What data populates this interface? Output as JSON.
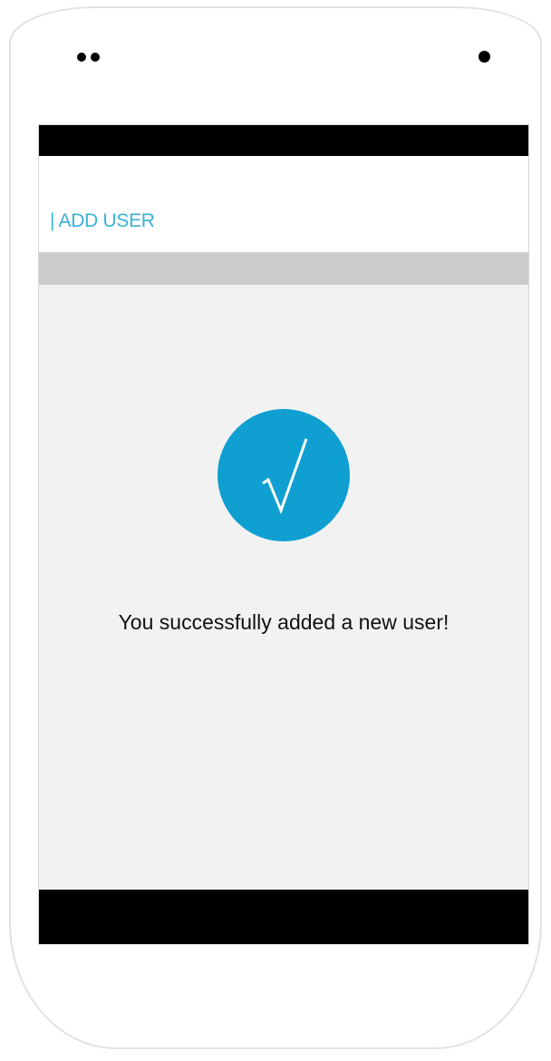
{
  "header": {
    "title": "| ADD USER"
  },
  "success": {
    "icon": "check-icon",
    "glyph": "√",
    "message": "You successfully added a new user!"
  },
  "colors": {
    "accent": "#3ab0d8",
    "success_circle": "#0f9fd1",
    "screen_background": "#f2f2f2",
    "sub_bar": "#cccccc",
    "system_bars": "#000000"
  }
}
